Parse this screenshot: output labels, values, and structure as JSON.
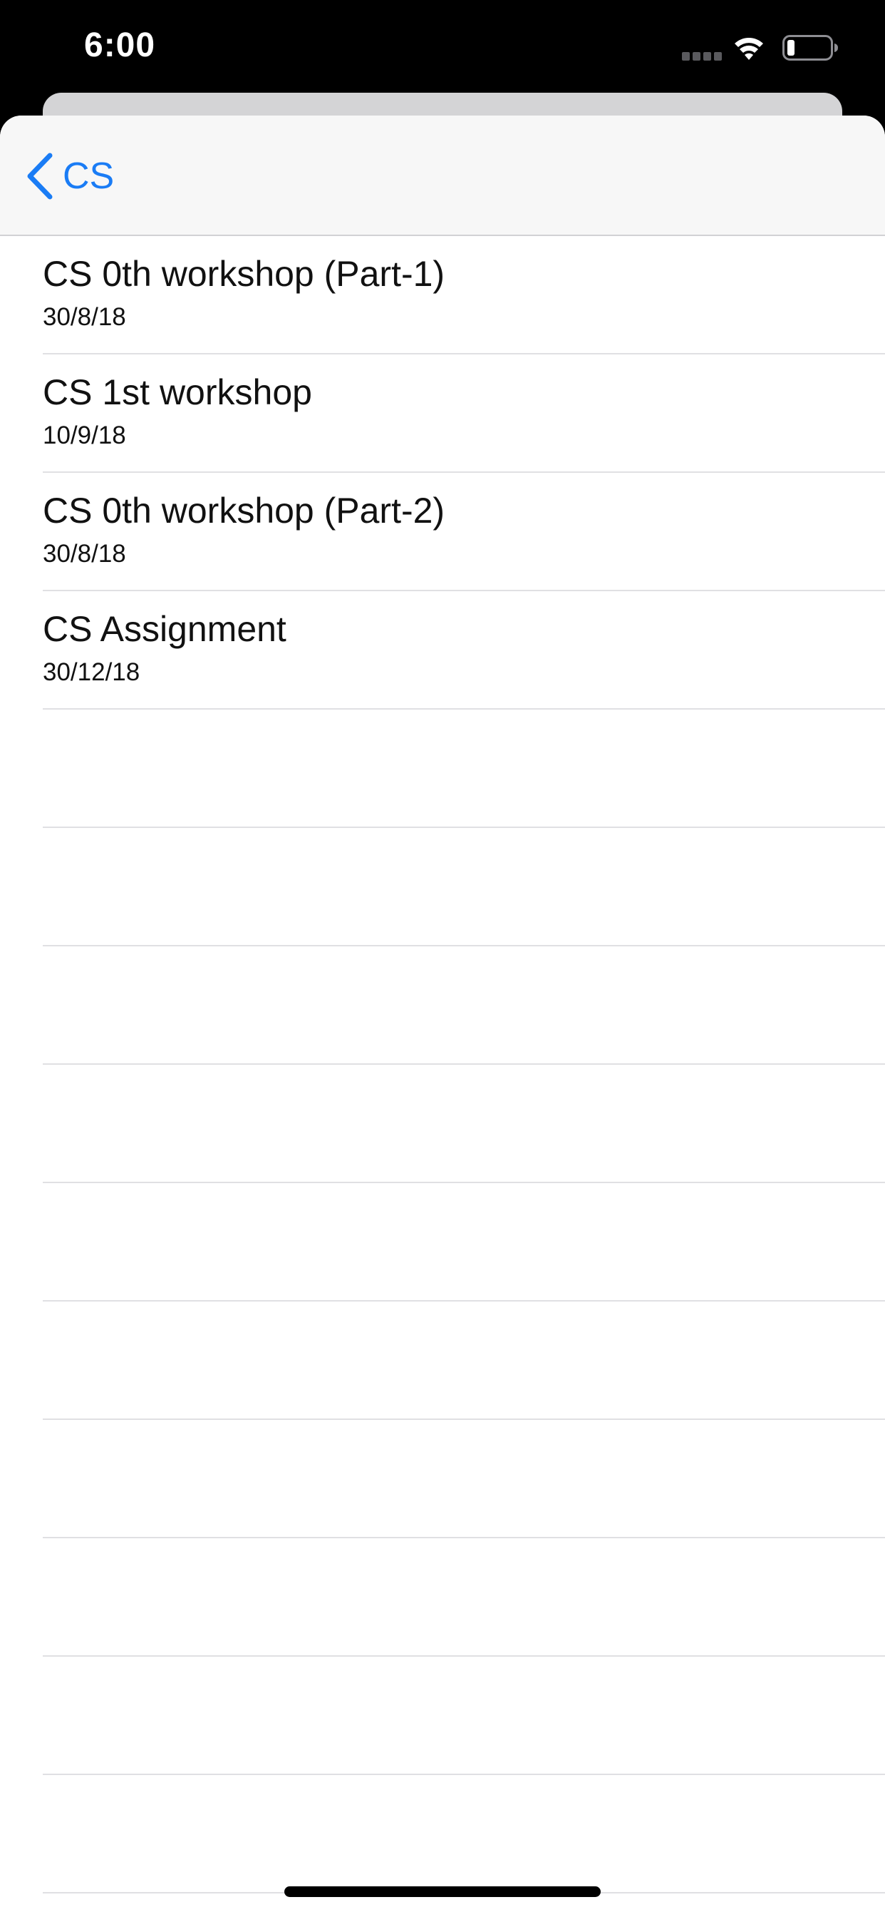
{
  "status_bar": {
    "time": "6:00",
    "icons": [
      "signal-dots-icon",
      "wifi-icon",
      "battery-icon"
    ]
  },
  "nav": {
    "back_label": "CS",
    "back_icon": "chevron-left-icon",
    "accent_color": "#1a7cf5"
  },
  "items": [
    {
      "title": "CS 0th workshop (Part-1)",
      "date": "30/8/18"
    },
    {
      "title": "CS 1st workshop",
      "date": "10/9/18"
    },
    {
      "title": "CS 0th workshop (Part-2)",
      "date": "30/8/18"
    },
    {
      "title": "CS Assignment",
      "date": "30/12/18"
    }
  ],
  "empty_rows": 10
}
